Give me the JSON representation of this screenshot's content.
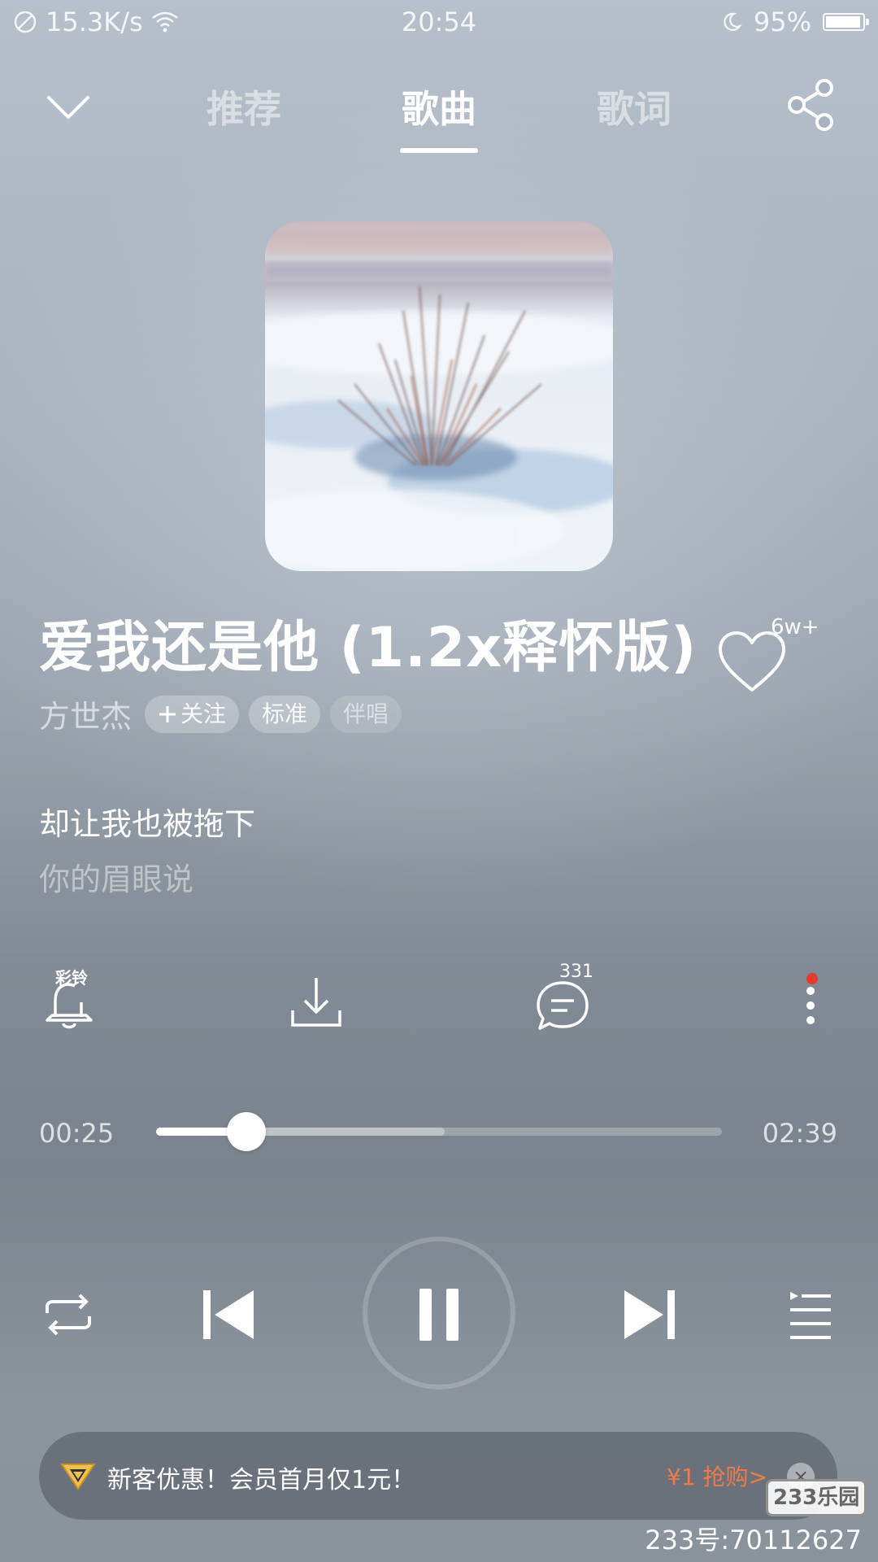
{
  "status_bar": {
    "speed": "15.3K/s",
    "time": "20:54",
    "battery_percent": "95%",
    "battery_level": 0.95
  },
  "nav": {
    "tabs": [
      {
        "label": "推荐",
        "active": false
      },
      {
        "label": "歌曲",
        "active": true
      },
      {
        "label": "歌词",
        "active": false
      }
    ]
  },
  "song": {
    "title": "爱我还是他 (1.2x释怀版)",
    "like_count": "6w+",
    "artist": "方世杰",
    "follow_label": "关注",
    "quality_label": "标准",
    "duet_label": "伴唱"
  },
  "lyrics": {
    "current": "却让我也被拖下",
    "next": "你的眉眼说"
  },
  "actions": {
    "ringtone_label": "彩铃",
    "comment_count": "331"
  },
  "progress": {
    "current": "00:25",
    "total": "02:39",
    "played_fraction": 0.16,
    "buffered_fraction": 0.51
  },
  "promo": {
    "text": "新客优惠！会员首月仅1元！",
    "price_cta": "¥1 抢购>",
    "close": "×"
  },
  "watermark": {
    "logo": "233乐园",
    "text": "233号:70112627"
  }
}
